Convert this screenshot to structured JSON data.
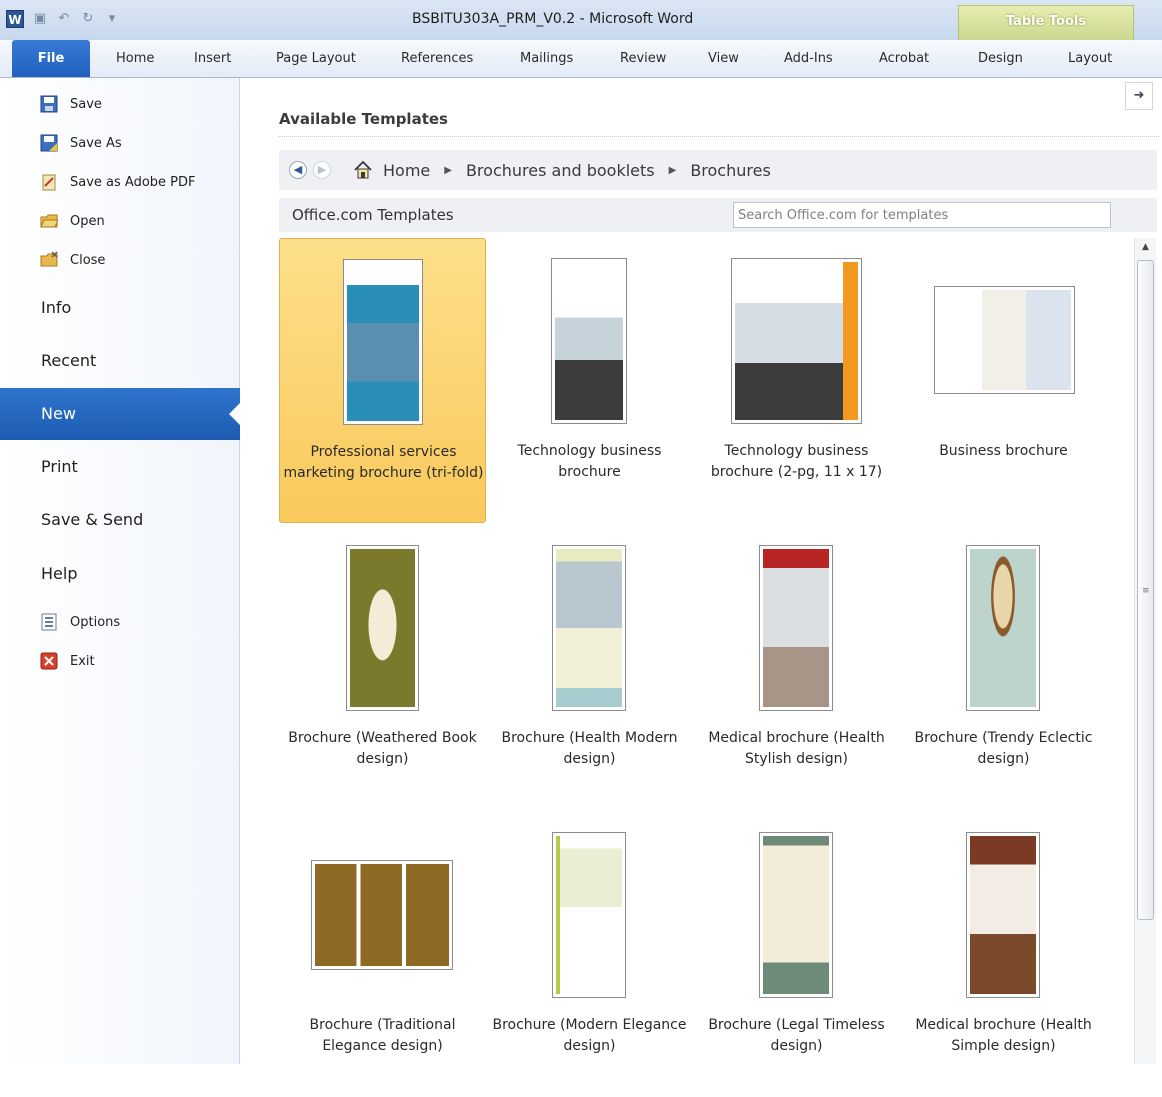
{
  "window": {
    "title": "BSBITU303A_PRM_V0.2  -  Microsoft Word",
    "logo_letter": "W",
    "context_group": "Table Tools"
  },
  "ribbon": {
    "file_tab": "File",
    "tabs": [
      "Home",
      "Insert",
      "Page Layout",
      "References",
      "Mailings",
      "Review",
      "View",
      "Add-Ins",
      "Acrobat",
      "Design",
      "Layout"
    ]
  },
  "backstage": {
    "commands": [
      {
        "label": "Save",
        "icon": "save-icon"
      },
      {
        "label": "Save As",
        "icon": "save-as-icon"
      },
      {
        "label": "Save as Adobe PDF",
        "icon": "pdf-icon"
      },
      {
        "label": "Open",
        "icon": "open-folder-icon"
      },
      {
        "label": "Close",
        "icon": "close-folder-icon"
      }
    ],
    "tabs": [
      "Info",
      "Recent",
      "New",
      "Print",
      "Save & Send",
      "Help"
    ],
    "active_tab": "New",
    "bottom_commands": [
      {
        "label": "Options",
        "icon": "options-icon"
      },
      {
        "label": "Exit",
        "icon": "exit-icon"
      }
    ]
  },
  "main": {
    "heading": "Available Templates",
    "breadcrumb": [
      "Home",
      "Brochures and booklets",
      "Brochures"
    ],
    "office_label": "Office.com Templates",
    "search_placeholder": "Search Office.com for templates",
    "templates": [
      {
        "label": "Professional services marketing brochure (tri-fold)",
        "selected": true
      },
      {
        "label": "Technology business brochure"
      },
      {
        "label": "Technology business brochure (2-pg, 11 x 17)"
      },
      {
        "label": "Business brochure"
      },
      {
        "label": "Brochure (Weathered Book design)"
      },
      {
        "label": "Brochure (Health Modern design)"
      },
      {
        "label": "Medical brochure (Health Stylish design)"
      },
      {
        "label": "Brochure (Trendy Eclectic design)"
      },
      {
        "label": "Brochure (Traditional Elegance design)"
      },
      {
        "label": "Brochure (Modern Elegance design)"
      },
      {
        "label": "Brochure (Legal Timeless design)"
      },
      {
        "label": "Medical brochure (Health Simple design)"
      }
    ]
  },
  "colors": {
    "accent": "#1d5cb3",
    "selected_tile": "#f9c95c",
    "context_tab": "#c8d58e"
  }
}
